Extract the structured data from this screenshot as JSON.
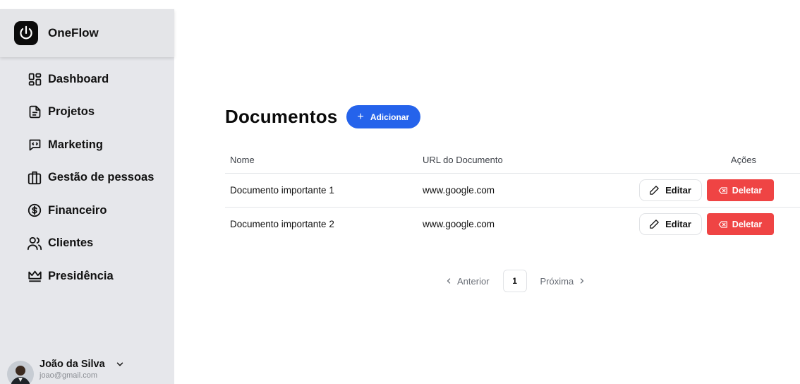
{
  "brand": {
    "name": "OneFlow",
    "icon": "power-icon"
  },
  "sidebar": {
    "items": [
      {
        "label": "Dashboard",
        "icon": "dashboard-grid-icon"
      },
      {
        "label": "Projetos",
        "icon": "document-icon"
      },
      {
        "label": "Marketing",
        "icon": "message-icon"
      },
      {
        "label": "Gestão de pessoas",
        "icon": "building-icon"
      },
      {
        "label": "Financeiro",
        "icon": "dollar-circle-icon"
      },
      {
        "label": "Clientes",
        "icon": "users-icon"
      },
      {
        "label": "Presidência",
        "icon": "crown-icon"
      }
    ]
  },
  "user": {
    "name": "João da Silva",
    "email": "joao@gmail.com"
  },
  "main": {
    "title": "Documentos",
    "add_label": "Adicionar",
    "table": {
      "headers": [
        "Nome",
        "URL do Documento",
        "Ações"
      ],
      "rows": [
        {
          "name": "Documento importante 1",
          "url": "www.google.com",
          "edit": "Editar",
          "delete": "Deletar"
        },
        {
          "name": "Documento importante 2",
          "url": "www.google.com",
          "edit": "Editar",
          "delete": "Deletar"
        }
      ]
    },
    "pagination": {
      "prev": "Anterior",
      "page": "1",
      "next": "Próxima"
    }
  },
  "colors": {
    "accent": "#2563eb",
    "danger": "#ef4444",
    "sidebar_bg": "#e6e7eb"
  }
}
